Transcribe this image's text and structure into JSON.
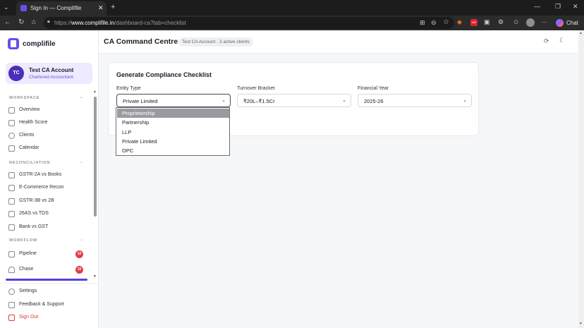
{
  "browser": {
    "tab_title": "Sign In — Complifile",
    "url_prefix": "https://",
    "url_host": "www.complifile.in",
    "url_path": "/dashboard-ca?tab=checklist",
    "chat_label": "Chat",
    "abp_label": "ABP"
  },
  "sidebar": {
    "brand": "complifile",
    "account": {
      "initials": "TC",
      "name": "Test CA Account",
      "role": "Chartered Accountant"
    },
    "sections": [
      {
        "label": "WORKSPACE",
        "items": [
          "Overview",
          "Health Score",
          "Clients",
          "Calendar"
        ]
      },
      {
        "label": "RECONCILIATION",
        "items": [
          "GSTR-2A vs Books",
          "E-Commerce Recon",
          "GSTR-3B vs 2B",
          "26AS vs TDS",
          "Bank vs GST"
        ]
      },
      {
        "label": "WORKFLOW",
        "items": [
          "Pipeline",
          "Chase"
        ]
      }
    ],
    "badges": {
      "pipeline": "10",
      "chase": "10"
    },
    "footer": {
      "settings": "Settings",
      "feedback": "Feedback & Support",
      "signout": "Sign Out"
    }
  },
  "header": {
    "title": "CA Command Centre",
    "subtitle_chip": "Test CA Account · 2 active clients"
  },
  "card": {
    "title": "Generate Compliance Checklist",
    "entity_label": "Entity Type",
    "entity_value": "Private Limited",
    "turnover_label": "Turnover Bracket",
    "turnover_value": "₹20L–₹1.5Cr",
    "fy_label": "Financial Year",
    "fy_value": "2025-26",
    "entity_options": [
      "Proprietorship",
      "Partnership",
      "LLP",
      "Private Limited",
      "OPC"
    ],
    "highlighted_option": "Proprietorship"
  },
  "colors": {
    "accent": "#6c4de6",
    "badge": "#e23d4b",
    "signout": "#d93a3a"
  }
}
